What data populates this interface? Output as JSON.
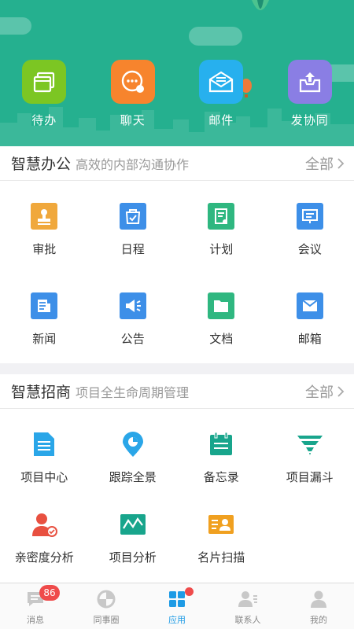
{
  "header": {
    "items": [
      {
        "label": "待办",
        "icon": "todo-icon",
        "color": "#7cc623"
      },
      {
        "label": "聊天",
        "icon": "chat-icon",
        "color": "#f7842d"
      },
      {
        "label": "邮件",
        "icon": "mail-icon",
        "color": "#27b0ee"
      },
      {
        "label": "发协同",
        "icon": "collab-icon",
        "color": "#8a7ee4"
      }
    ]
  },
  "office": {
    "title": "智慧办公",
    "subtitle": "高效的内部沟通协作",
    "all_label": "全部",
    "items": [
      {
        "label": "审批",
        "icon": "approval-icon",
        "color": "#f0a83c"
      },
      {
        "label": "日程",
        "icon": "schedule-icon",
        "color": "#3d8fe8"
      },
      {
        "label": "计划",
        "icon": "plan-icon",
        "color": "#2fb780"
      },
      {
        "label": "会议",
        "icon": "meeting-icon",
        "color": "#3d8fe8"
      },
      {
        "label": "新闻",
        "icon": "news-icon",
        "color": "#3d8fe8"
      },
      {
        "label": "公告",
        "icon": "announcement-icon",
        "color": "#3d8fe8"
      },
      {
        "label": "文档",
        "icon": "document-icon",
        "color": "#2fb780"
      },
      {
        "label": "邮箱",
        "icon": "mailbox-icon",
        "color": "#3d8fe8"
      }
    ]
  },
  "investment": {
    "title": "智慧招商",
    "subtitle": "项目全生命周期管理",
    "all_label": "全部",
    "items": [
      {
        "label": "项目中心",
        "icon": "project-center-icon",
        "color": "#2aa6e8"
      },
      {
        "label": "跟踪全景",
        "icon": "tracking-icon",
        "color": "#2aa6e8"
      },
      {
        "label": "备忘录",
        "icon": "memo-icon",
        "color": "#18a58c"
      },
      {
        "label": "项目漏斗",
        "icon": "funnel-icon",
        "color": "#18a58c"
      },
      {
        "label": "亲密度分析",
        "icon": "intimacy-icon",
        "color": "#e85040"
      },
      {
        "label": "项目分析",
        "icon": "analysis-icon",
        "color": "#18a58c"
      },
      {
        "label": "名片扫描",
        "icon": "card-scan-icon",
        "color": "#f0a020"
      }
    ]
  },
  "tabbar": {
    "tabs": [
      {
        "label": "消息",
        "icon": "message-icon",
        "badge": "86"
      },
      {
        "label": "同事圈",
        "icon": "moments-icon"
      },
      {
        "label": "应用",
        "icon": "apps-icon",
        "active": true
      },
      {
        "label": "联系人",
        "icon": "contacts-icon"
      },
      {
        "label": "我的",
        "icon": "profile-icon"
      }
    ],
    "active_color": "#1e9be5"
  }
}
